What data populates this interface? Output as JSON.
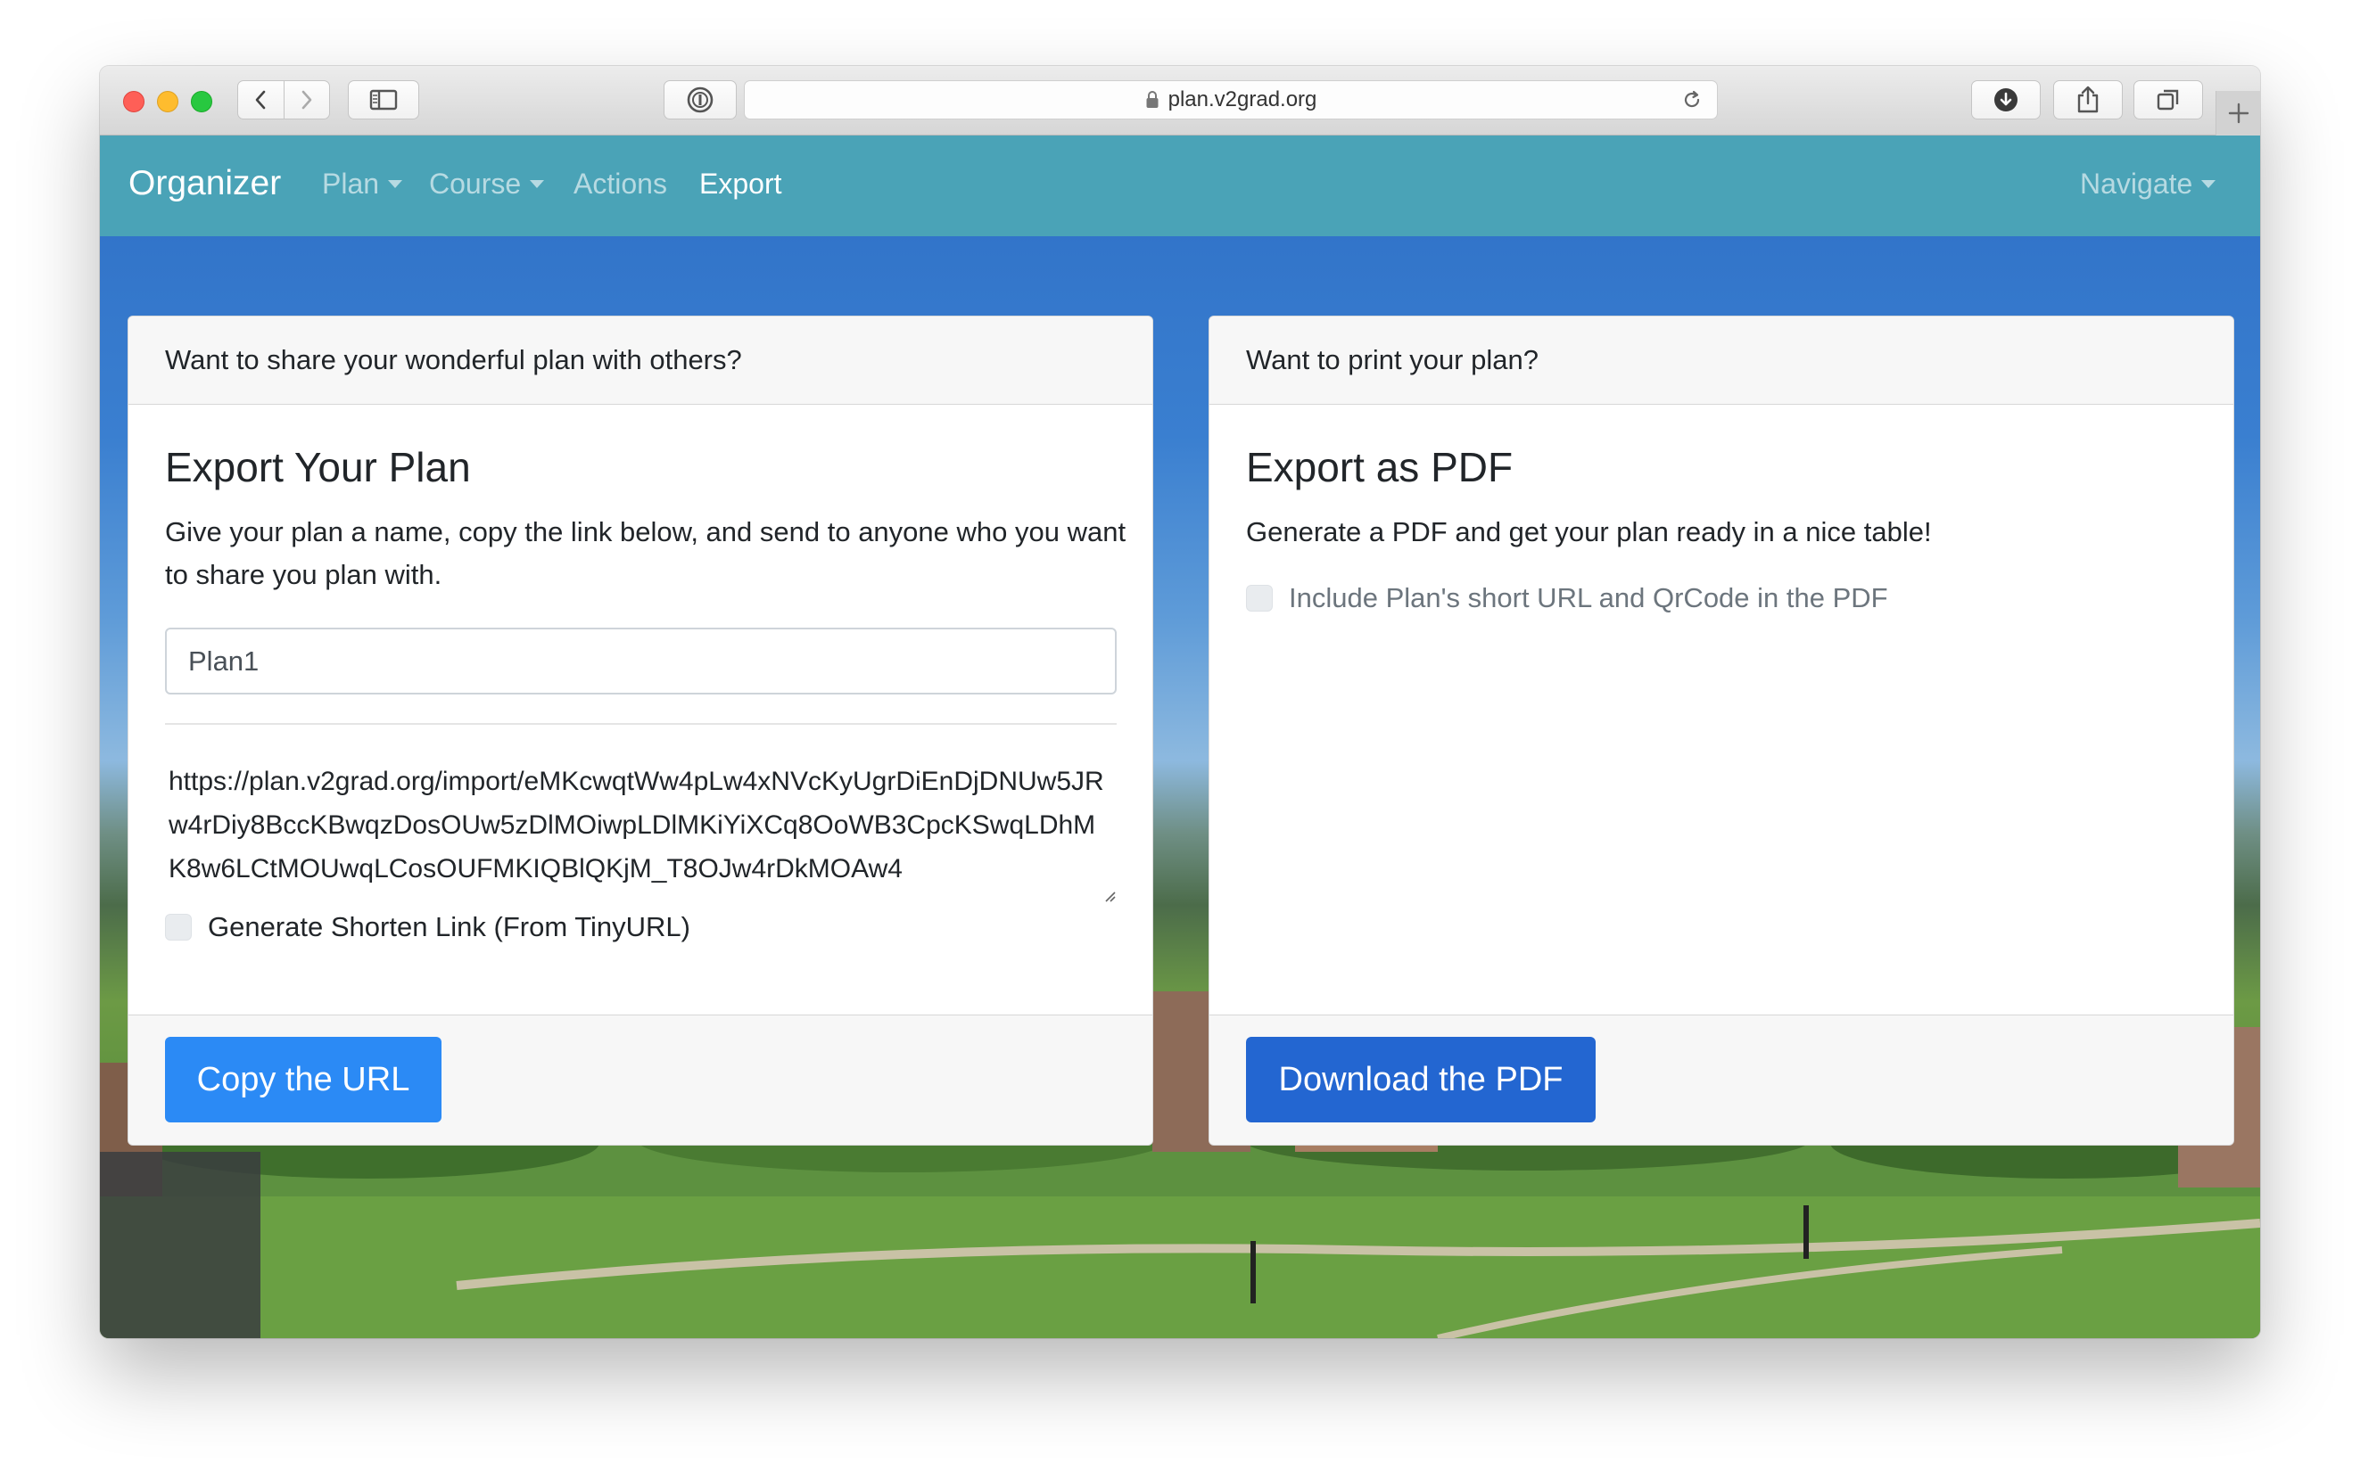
{
  "browser": {
    "url": "plan.v2grad.org"
  },
  "navbar": {
    "brand": "Organizer",
    "items": [
      {
        "label": "Plan",
        "dropdown": true
      },
      {
        "label": "Course",
        "dropdown": true
      },
      {
        "label": "Actions",
        "dropdown": false
      },
      {
        "label": "Export",
        "dropdown": false,
        "active": true
      }
    ],
    "right_item": {
      "label": "Navigate",
      "dropdown": true
    },
    "color": "#4aa3b7"
  },
  "share_card": {
    "header": "Want to share your wonderful plan with others?",
    "title": "Export Your Plan",
    "text": "Give your plan a name, copy the link below, and send to anyone who you want to share you plan with.",
    "name_input_value": "Plan1",
    "url_value": "https://plan.v2grad.org/import/eMKcwqtWw4pLw4xNVcKyUgrDiEnDjDNUw5JRw4rDiy8BccKBwqzDosOUw5zDlMOiwpLDlMKiYiXCq8OoWB3CpcKSwqLDhMK8w6LCtMOUwqLCosOUFMKIQBlQKjM_T8OJw4rDkMOAw4",
    "shorten_checkbox_label": "Generate Shorten Link (From TinyURL)",
    "shorten_checked": false,
    "button_label": "Copy the URL",
    "button_color": "#2b8af5"
  },
  "pdf_card": {
    "header": "Want to print your plan?",
    "title": "Export as PDF",
    "text": "Generate a PDF and get your plan ready in a nice table!",
    "include_checkbox_label": "Include Plan's short URL and QrCode in the PDF",
    "include_checked": false,
    "button_label": "Download the PDF",
    "button_color": "#2366d1"
  }
}
